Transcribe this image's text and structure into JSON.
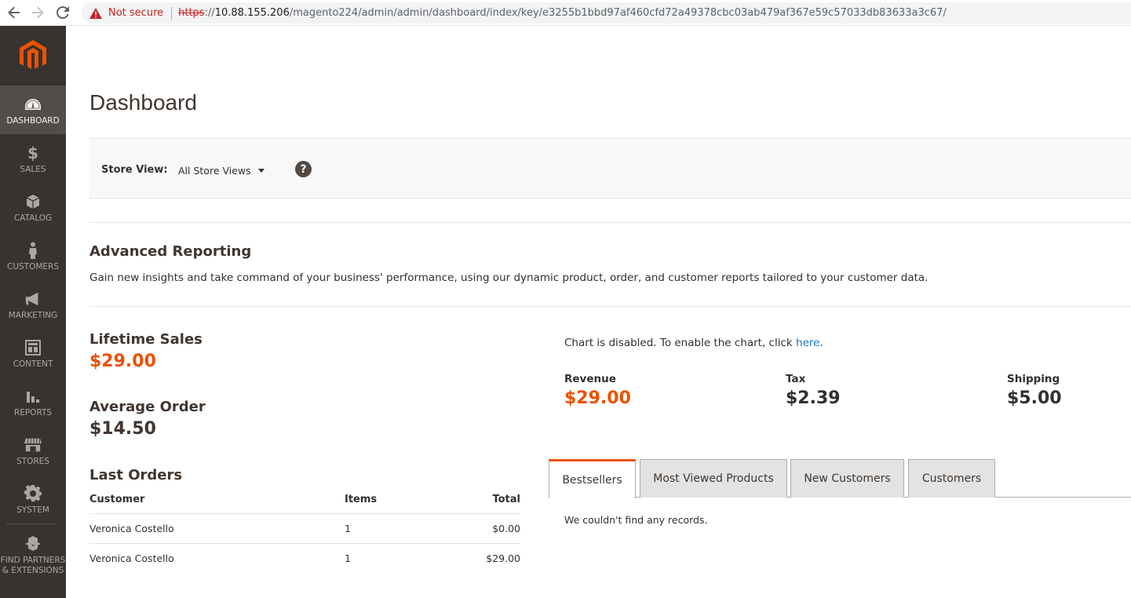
{
  "browser": {
    "security_label": "Not secure",
    "url_protocol": "https",
    "url_separator": "://",
    "url_host": "10.88.155.206",
    "url_path": "/magento224/admin/admin/dashboard/index/key/e3255b1bbd97af460cfd72a49378cbc03ab479af367e59c57033db83633a3c67/"
  },
  "sidebar": {
    "items": [
      {
        "label": "DASHBOARD",
        "icon": "dashboard-icon",
        "active": true
      },
      {
        "label": "SALES",
        "icon": "dollar-icon"
      },
      {
        "label": "CATALOG",
        "icon": "box-icon"
      },
      {
        "label": "CUSTOMERS",
        "icon": "person-icon"
      },
      {
        "label": "MARKETING",
        "icon": "megaphone-icon"
      },
      {
        "label": "CONTENT",
        "icon": "layout-icon"
      },
      {
        "label": "REPORTS",
        "icon": "bar-chart-icon"
      },
      {
        "label": "STORES",
        "icon": "storefront-icon"
      },
      {
        "label": "SYSTEM",
        "icon": "gear-icon"
      }
    ],
    "partners_line1": "FIND PARTNERS",
    "partners_line2": "& EXTENSIONS"
  },
  "page": {
    "title": "Dashboard"
  },
  "store_view": {
    "label": "Store View:",
    "selected": "All Store Views",
    "help": "?"
  },
  "advanced_reporting": {
    "title": "Advanced Reporting",
    "text": "Gain new insights and take command of your business' performance, using our dynamic product, order, and customer reports tailored to your customer data."
  },
  "stats": {
    "lifetime_sales_label": "Lifetime Sales",
    "lifetime_sales_value": "$29.00",
    "average_order_label": "Average Order",
    "average_order_value": "$14.50"
  },
  "last_orders": {
    "title": "Last Orders",
    "headers": {
      "customer": "Customer",
      "items": "Items",
      "total": "Total"
    },
    "rows": [
      {
        "customer": "Veronica Costello",
        "items": "1",
        "total": "$0.00"
      },
      {
        "customer": "Veronica Costello",
        "items": "1",
        "total": "$29.00"
      }
    ]
  },
  "chart": {
    "message": "Chart is disabled. To enable the chart, click ",
    "link": "here",
    "suffix": "."
  },
  "totals": {
    "revenue_label": "Revenue",
    "revenue_value": "$29.00",
    "tax_label": "Tax",
    "tax_value": "$2.39",
    "shipping_label": "Shipping",
    "shipping_value": "$5.00"
  },
  "tabs": {
    "items": [
      "Bestsellers",
      "Most Viewed Products",
      "New Customers",
      "Customers"
    ],
    "empty_message": "We couldn't find any records."
  },
  "colors": {
    "accent": "#eb5202",
    "sidebar_bg": "#373330",
    "link": "#1979c3"
  }
}
